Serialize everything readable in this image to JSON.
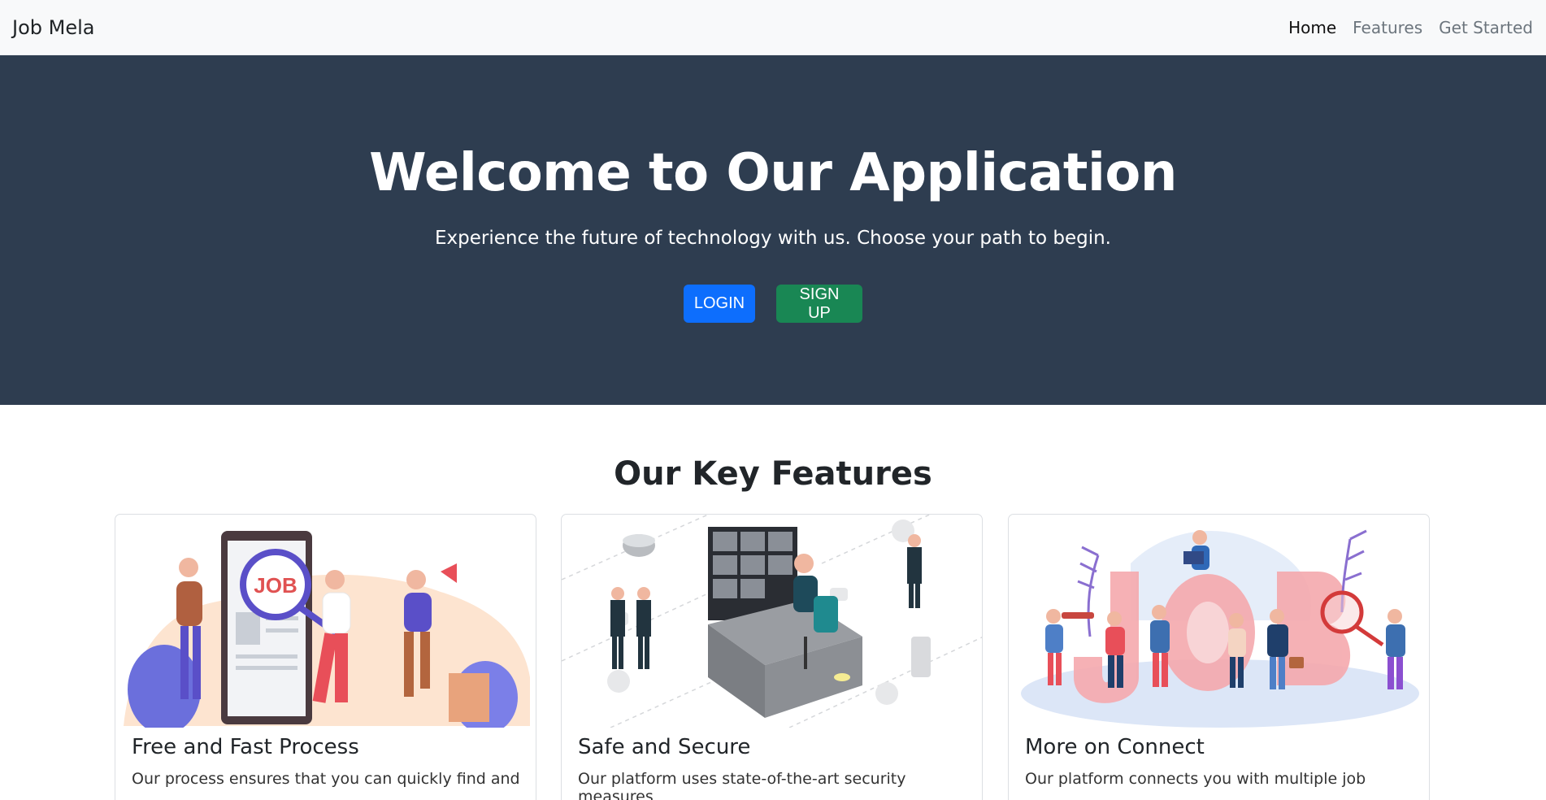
{
  "navbar": {
    "brand": "Job Mela",
    "links": [
      {
        "label": "Home",
        "active": true
      },
      {
        "label": "Features",
        "active": false
      },
      {
        "label": "Get Started",
        "active": false
      }
    ]
  },
  "hero": {
    "title": "Welcome to Our Application",
    "subtitle": "Experience the future of technology with us. Choose your path to begin.",
    "login_label": "LOGIN",
    "signup_label": "SIGN UP"
  },
  "features": {
    "heading": "Our Key Features",
    "cards": [
      {
        "title": "Free and Fast Process",
        "text": "Our process ensures that you can quickly find and",
        "illustration": "job-search-illustration",
        "image_text": "JOB"
      },
      {
        "title": "Safe and Secure",
        "text": "Our platform uses state-of-the-art security measures",
        "illustration": "security-monitoring-illustration"
      },
      {
        "title": "More on Connect",
        "text": "Our platform connects you with multiple job",
        "illustration": "job-connect-illustration"
      }
    ]
  },
  "colors": {
    "hero_bg": "#2e3d50",
    "login": "#0d6efd",
    "signup": "#198754"
  }
}
